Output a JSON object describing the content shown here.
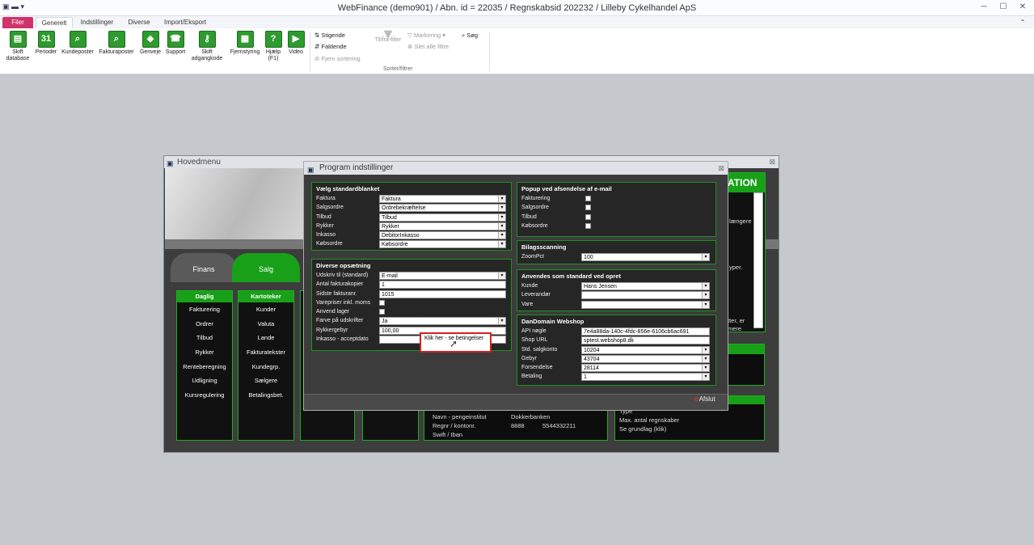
{
  "window": {
    "title": "WebFinance (demo901) / Abn. id = 22035 / Regnskabsid 202232 / Lilleby Cykelhandel ApS"
  },
  "ribbon_tabs": [
    "Filer",
    "Generelt",
    "Indstillinger",
    "Diverse",
    "Import/Eksport"
  ],
  "ribbon_buttons": [
    {
      "label": "Skift\ndatabase",
      "icon": "database-icon",
      "glyph": "▤"
    },
    {
      "label": "Perioder",
      "icon": "calendar-icon",
      "glyph": "31"
    },
    {
      "label": "Kundeposter",
      "icon": "magnifier-icon",
      "glyph": "⌕"
    },
    {
      "label": "Fakturaposter",
      "icon": "invoice-search-icon",
      "glyph": "⌕"
    },
    {
      "label": "Genveje",
      "icon": "cube-icon",
      "glyph": "◈"
    },
    {
      "label": "Support",
      "icon": "phone-icon",
      "glyph": "☎"
    },
    {
      "label": "Skift\nadgangkode",
      "icon": "key-icon",
      "glyph": "⚷"
    },
    {
      "label": "Fjernstyring",
      "icon": "remote-icon",
      "glyph": "▦"
    },
    {
      "label": "Hjælp\n(F1)",
      "icon": "help-icon",
      "glyph": "?"
    },
    {
      "label": "Video",
      "icon": "video-icon",
      "glyph": "▶"
    }
  ],
  "sort_filter": {
    "stigende": "Stigende",
    "faldende": "Faldende",
    "fjern_sortering": "Fjern sortering",
    "til_fra_filter": "Til/fra-filter",
    "markering": "Markering",
    "slet_alle_filtre": "Slet alle filtre",
    "sog": "Søg",
    "group_label": "Sorter/filtrer"
  },
  "hovedmenu": {
    "title": "Hovedmenu",
    "tabs": [
      "Finans",
      "Salg"
    ],
    "columns": [
      {
        "header": "Daglig",
        "items": [
          "Fakturering",
          "Ordrer",
          "Tilbud",
          "Rykker",
          "Renteberegning",
          "Udligning",
          "Kursregulering"
        ]
      },
      {
        "header": "Kartoteker",
        "items": [
          "Kunder",
          "Valuta",
          "Lande",
          "Fakturatekster",
          "Kundegrp.",
          "Sælgere",
          "Betalingsbet."
        ]
      }
    ],
    "right_banner": "ATION",
    "right_snippets": [
      "længere",
      "yper.",
      "tter, er",
      "mere"
    ],
    "bank": {
      "navn_label": "Navn - pengeinstitut",
      "navn_value": "Dokkerbanken",
      "regnr_label": "Regnr / kontonr.",
      "regnr_value": "8888",
      "konto_value": "5544332211",
      "swift_label": "Swift / Iban"
    },
    "right_bottom": [
      "Type",
      "Max. antal regnskaber",
      "Se grundlag (klik)"
    ]
  },
  "dialog": {
    "title": "Program indstillinger",
    "standardblanket": {
      "title": "Vælg standardblanket",
      "rows": [
        {
          "label": "Faktura",
          "value": "Faktura"
        },
        {
          "label": "Salgsordre",
          "value": "Ordrebekræftelse"
        },
        {
          "label": "Tilbud",
          "value": "Tilbud"
        },
        {
          "label": "Rykker",
          "value": "Rykker"
        },
        {
          "label": "Inkasso",
          "value": "DebitorInkasso"
        },
        {
          "label": "Købsordre",
          "value": "Købsordre"
        }
      ]
    },
    "diverse": {
      "title": "Diverse opsætning",
      "udskriv_label": "Udskriv til (standard)",
      "udskriv_value": "E-mail",
      "kopier_label": "Antal fakturakopier",
      "kopier_value": "1",
      "sidste_label": "Sidste fakturanr.",
      "sidste_value": "1015",
      "varepriser_label": "Varepriser inkl. moms",
      "lager_label": "Anvend lager",
      "farve_label": "Farve på udskrifter",
      "farve_value": "Ja",
      "gebyr_label": "Rykkergebyr",
      "gebyr_value": "100,00",
      "accept_label": "Inkasso - acceptdato",
      "klik_text": "Klik her - se betingelser"
    },
    "popup": {
      "title": "Popup ved afsendelse af e-mail",
      "rows": [
        {
          "label": "Fakturering",
          "checked": "✓"
        },
        {
          "label": "Salgsordre",
          "checked": ""
        },
        {
          "label": "Tilbud",
          "checked": ""
        },
        {
          "label": "Købsordre",
          "checked": ""
        }
      ]
    },
    "bilag": {
      "title": "Bilagsscanning",
      "zoom_label": "ZoomPct",
      "zoom_value": "100"
    },
    "anvendes": {
      "title": "Anvendes som standard ved opret",
      "kunde_label": "Kunde",
      "kunde_value": "Hans Jensen",
      "leverandor_label": "Leverandør",
      "leverandor_value": "",
      "vare_label": "Vare",
      "vare_value": ""
    },
    "dandomain": {
      "title": "DanDomain Webshop",
      "rows": [
        {
          "label": "API nøgle",
          "value": "7e4a88da-140c-4fdc-856e-6106cb6ac691",
          "dd": ""
        },
        {
          "label": "Shop URL",
          "value": "sptest.webshop8.dk",
          "dd": ""
        },
        {
          "label": "Std. salgkonto",
          "value": "10204",
          "dd": "▾"
        },
        {
          "label": "Gebyr",
          "value": "43704",
          "dd": "▾"
        },
        {
          "label": "Forsendelse",
          "value": "28114",
          "dd": "▾"
        },
        {
          "label": "Betaling",
          "value": "1",
          "dd": "▾"
        }
      ]
    },
    "afslut": "Afslut"
  }
}
